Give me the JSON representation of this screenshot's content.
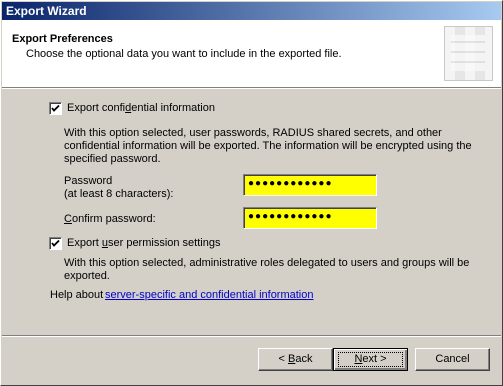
{
  "window": {
    "title": "Export Wizard"
  },
  "header": {
    "title": "Export Preferences",
    "subtitle": "Choose the optional data you want to include in the exported file."
  },
  "confidential": {
    "checked": true,
    "label_before": "Export confi",
    "label_mnemonic": "d",
    "label_after": "ential information",
    "description": "With this option selected, user passwords, RADIUS shared secrets, and other confidential information will be exported. The information will be encrypted using the specified password.",
    "password_label_line1": "Password",
    "password_label_line2": "(at least 8 characters):",
    "password_value": "●●●●●●●●●●●●",
    "confirm_mnemonic": "C",
    "confirm_rest": "onfirm password:",
    "confirm_value": "●●●●●●●●●●●●"
  },
  "permissions": {
    "checked": true,
    "label_before": "Export ",
    "label_mnemonic": "u",
    "label_after": "ser permission settings",
    "description": "With this option selected, administrative roles delegated to users and groups will be exported."
  },
  "help": {
    "prefix": "Help about ",
    "link_text": "server-specific and confidential information"
  },
  "buttons": {
    "back_prefix": "< ",
    "back_mnemonic": "B",
    "back_rest": "ack",
    "next_mnemonic": "N",
    "next_rest": "ext >",
    "cancel": "Cancel"
  }
}
